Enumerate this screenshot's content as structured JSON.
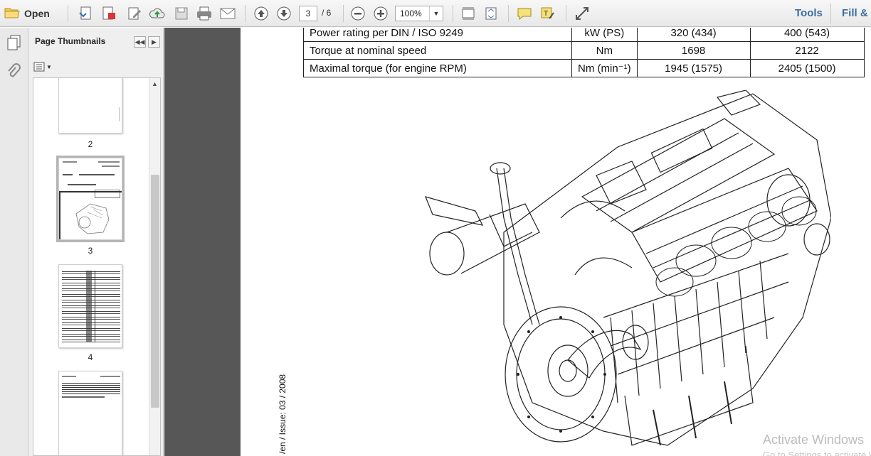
{
  "toolbar": {
    "open_label": "Open",
    "current_page": "3",
    "total_pages": "/ 6",
    "zoom": "100%",
    "tools_label": "Tools",
    "fill_sign_label": "Fill &"
  },
  "thumbnail_panel": {
    "title": "Page Thumbnails",
    "pages": [
      {
        "label": "2"
      },
      {
        "label": "3",
        "selected": true
      },
      {
        "label": "4"
      },
      {
        "label": ""
      }
    ]
  },
  "document": {
    "spec_table": [
      [
        "Power rating per DIN / ISO 9249",
        "kW (PS)",
        "320 (434)",
        "400 (543)"
      ],
      [
        "Torque at nominal speed",
        "Nm",
        "1698",
        "2122"
      ],
      [
        "Maximal torque (for engine RPM)",
        "Nm (min⁻¹)",
        "1945 (1575)",
        "2405 (1500)"
      ]
    ],
    "vertical_footer": "/en / Issue: 03 / 2008"
  },
  "watermark": {
    "line1": "Activate Windows",
    "line2": "Go to Settings to activate Windows."
  }
}
